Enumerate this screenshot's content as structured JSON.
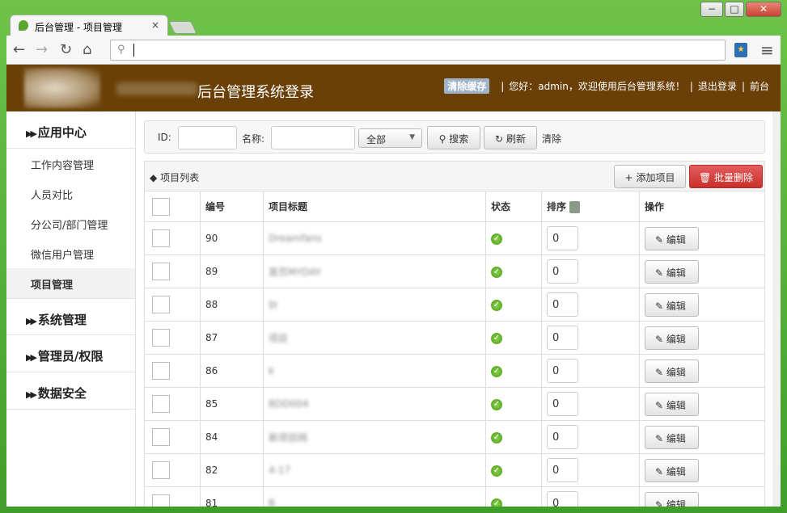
{
  "browser": {
    "tab_title": "后台管理 - 项目管理",
    "tab_close": "×",
    "back": "←",
    "forward": "→",
    "reload": "↻",
    "home": "⌂",
    "address_value": "",
    "menu_icon": "≡",
    "win_min": "−",
    "win_max": "□",
    "win_close": "✕"
  },
  "header": {
    "blurred_site_name": "首页MyDay",
    "title": "后台管理系统登录",
    "clear_cache": "清除缓存",
    "greeting": "您好：admin，欢迎使用后台管理系统！",
    "logout": "退出登录",
    "frontend": "前台"
  },
  "sidebar": {
    "groups": [
      {
        "label": "应用中心",
        "items": [
          "工作内容管理",
          "人员对比",
          "分公司/部门管理",
          "微信用户管理",
          "项目管理"
        ]
      },
      {
        "label": "系统管理"
      },
      {
        "label": "管理员/权限"
      },
      {
        "label": "数据安全"
      }
    ],
    "arrow": "▶▶",
    "active_item": "项目管理"
  },
  "filter": {
    "id_label": "ID:",
    "id_value": "",
    "name_label": "名称:",
    "name_value": "",
    "status_select": "全部",
    "search": "搜索",
    "refresh": "刷新",
    "clear": "清除"
  },
  "list": {
    "title": "项目列表",
    "add": "添加项目",
    "batch_delete": "批量删除",
    "columns": [
      "",
      "编号",
      "项目标题",
      "状态",
      "排序",
      "操作"
    ],
    "rows": [
      {
        "id": "90",
        "title": "Dreamfans",
        "sort": "0",
        "action": "编辑"
      },
      {
        "id": "89",
        "title": "首页MYDAY",
        "sort": "0",
        "action": "编辑"
      },
      {
        "id": "88",
        "title": "针",
        "sort": "0",
        "action": "编辑"
      },
      {
        "id": "87",
        "title": "项目",
        "sort": "0",
        "action": "编辑"
      },
      {
        "id": "86",
        "title": "k",
        "sort": "0",
        "action": "编辑"
      },
      {
        "id": "85",
        "title": "BDD004",
        "sort": "0",
        "action": "编辑"
      },
      {
        "id": "84",
        "title": "新项目网",
        "sort": "0",
        "action": "编辑"
      },
      {
        "id": "82",
        "title": "4-17",
        "sort": "0",
        "action": "编辑"
      },
      {
        "id": "81",
        "title": "B",
        "sort": "0",
        "action": "编辑"
      }
    ]
  },
  "colors": {
    "header_bg": "#6a4008",
    "status_ok": "#4a9c14",
    "danger": "#c9302c",
    "frame_green": "#4fa83a"
  }
}
